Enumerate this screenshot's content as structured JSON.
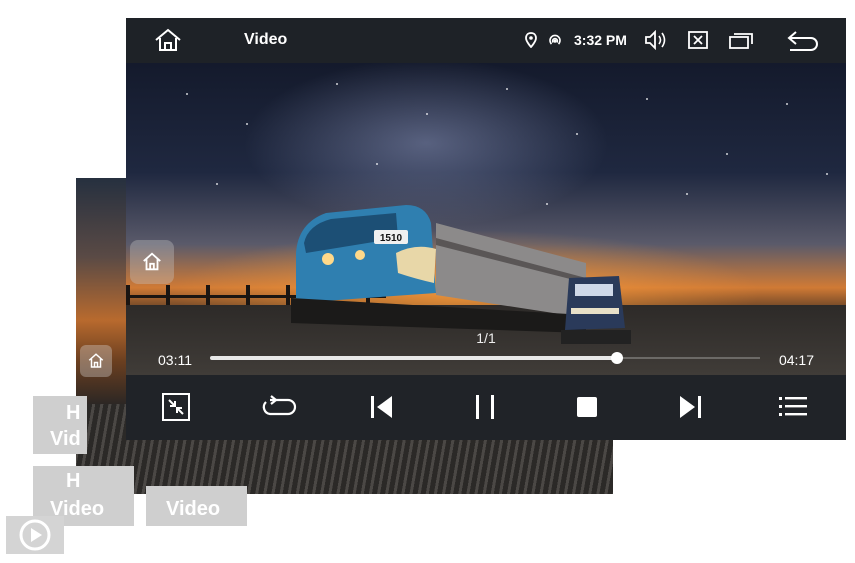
{
  "statusbar": {
    "title": "Video",
    "time": "3:32 PM",
    "icons": [
      "home-icon",
      "location-icon",
      "hotspot-icon",
      "volume-icon",
      "close-box-icon",
      "windows-icon",
      "back-icon"
    ]
  },
  "player": {
    "counter": "1/1",
    "current_time": "03:11",
    "total_time": "04:17",
    "progress": 0.74,
    "controls": [
      "shrink-icon",
      "repeat-icon",
      "previous-icon",
      "pause-icon",
      "stop-icon",
      "next-icon",
      "playlist-icon"
    ]
  },
  "tiles": {
    "a_line1": "H",
    "a_line2": "Vid",
    "b_line1": "H",
    "b_line2": "Video",
    "c_label": "Video"
  },
  "train_number": "1510",
  "colors": {
    "bar": "#1e2227",
    "controls": "#202328",
    "tile": "#cfcfcf"
  }
}
